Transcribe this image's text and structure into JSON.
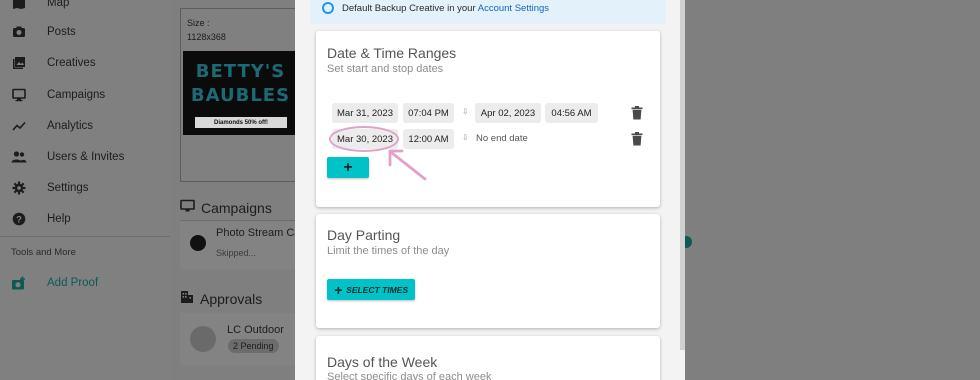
{
  "sidebar": {
    "items": [
      {
        "label": "Map",
        "icon": "map-icon"
      },
      {
        "label": "Posts",
        "icon": "camera-icon"
      },
      {
        "label": "Creatives",
        "icon": "photo-library-icon"
      },
      {
        "label": "Campaigns",
        "icon": "monitor-icon"
      },
      {
        "label": "Analytics",
        "icon": "trending-icon"
      },
      {
        "label": "Users & Invites",
        "icon": "people-icon"
      },
      {
        "label": "Settings",
        "icon": "gear-icon"
      },
      {
        "label": "Help",
        "icon": "help-icon"
      }
    ],
    "tools_label": "Tools and More",
    "add_proof": {
      "label": "Add Proof",
      "icon": "add-photo-icon"
    }
  },
  "background": {
    "preview": {
      "size_label": "Size :",
      "size_value": "1128x368",
      "image_text_line1": "BETTY'S",
      "image_text_line2": "BAUBLES",
      "image_banner": "Diamonds 50% off!"
    },
    "campaigns": {
      "heading": "Campaigns",
      "row_title": "Photo Stream Ca",
      "row_status": "Skipped..."
    },
    "approvals": {
      "heading": "Approvals",
      "row_title": "LC Outdoor",
      "row_badge": "2 Pending"
    }
  },
  "modal": {
    "info_banner": {
      "text_before": "Default Backup Creative",
      "text_middle": " in your ",
      "link": "Account Settings"
    },
    "date_time": {
      "title": "Date & Time Ranges",
      "subtitle": "Set start and stop dates",
      "ranges": [
        {
          "start_date": "Mar 31, 2023",
          "start_time": "07:04 PM",
          "end_date": "Apr 02, 2023",
          "end_time": "04:56 AM"
        },
        {
          "start_date": "Mar 30, 2023",
          "start_time": "12:00 AM",
          "end_label": "No end date"
        }
      ],
      "add_label": "+"
    },
    "day_parting": {
      "title": "Day Parting",
      "subtitle": "Limit the times of the day",
      "button_label": "SELECT TIMES"
    },
    "days_of_week": {
      "title": "Days of the Week",
      "subtitle": "Select specific days of each week"
    }
  },
  "colors": {
    "accent": "#00c2c7",
    "overlay": "#7f7f7f",
    "highlight": "#e0a3c8",
    "info_bg": "#e3f1fb"
  }
}
